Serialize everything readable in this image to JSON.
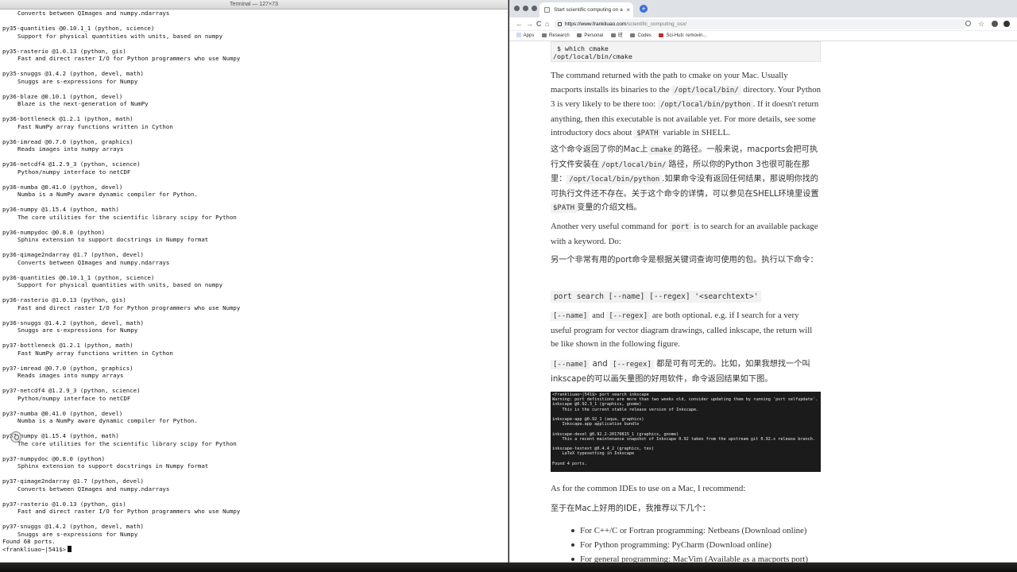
{
  "terminal": {
    "title": "Terminal — 127×73",
    "entries": [
      {
        "head": null,
        "desc": "Converts between QImages and numpy.ndarrays"
      },
      {
        "head": "py35-quantities @0.10.1_1 (python, science)",
        "desc": "Support for physical quantities with units, based on numpy"
      },
      {
        "head": "py35-rasterio @1.0.13 (python, gis)",
        "desc": "Fast and direct raster I/O for Python programmers who use Numpy"
      },
      {
        "head": "py35-snuggs @1.4.2 (python, devel, math)",
        "desc": "Snuggs are s-expressions for Numpy"
      },
      {
        "head": "py36-blaze @0.10.1 (python, devel)",
        "desc": "Blaze is the next-generation of NumPy"
      },
      {
        "head": "py36-bottleneck @1.2.1 (python, math)",
        "desc": "Fast NumPy array functions written in Cython"
      },
      {
        "head": "py36-imread @0.7.0 (python, graphics)",
        "desc": "Reads images into numpy arrays"
      },
      {
        "head": "py36-netcdf4 @1.2.9_3 (python, science)",
        "desc": "Python/numpy interface to netCDF"
      },
      {
        "head": "py36-numba @0.41.0 (python, devel)",
        "desc": "Numba is a NumPy aware dynamic compiler for Python."
      },
      {
        "head": "py36-numpy @1.15.4 (python, math)",
        "desc": "The core utilities for the scientific library scipy for Python"
      },
      {
        "head": "py36-numpydoc @0.8.0 (python)",
        "desc": "Sphinx extension to support docstrings in Numpy format"
      },
      {
        "head": "py36-qimage2ndarray @1.7 (python, devel)",
        "desc": "Converts between QImages and numpy.ndarrays"
      },
      {
        "head": "py36-quantities @0.10.1_1 (python, science)",
        "desc": "Support for physical quantities with units, based on numpy"
      },
      {
        "head": "py36-rasterio @1.0.13 (python, gis)",
        "desc": "Fast and direct raster I/O for Python programmers who use Numpy"
      },
      {
        "head": "py36-snuggs @1.4.2 (python, devel, math)",
        "desc": "Snuggs are s-expressions for Numpy"
      },
      {
        "head": "py37-bottleneck @1.2.1 (python, math)",
        "desc": "Fast NumPy array functions written in Cython"
      },
      {
        "head": "py37-imread @0.7.0 (python, graphics)",
        "desc": "Reads images into numpy arrays"
      },
      {
        "head": "py37-netcdf4 @1.2.9_3 (python, science)",
        "desc": "Python/numpy interface to netCDF"
      },
      {
        "head": "py37-numba @0.41.0 (python, devel)",
        "desc": "Numba is a NumPy aware dynamic compiler for Python."
      },
      {
        "head": "py37-numpy @1.15.4 (python, math)",
        "desc": "The core utilities for the scientific library scipy for Python"
      },
      {
        "head": "py37-numpydoc @0.8.0 (python)",
        "desc": "Sphinx extension to support docstrings in Numpy format"
      },
      {
        "head": "py37-qimage2ndarray @1.7 (python, devel)",
        "desc": "Converts between QImages and numpy.ndarrays"
      },
      {
        "head": "py37-rasterio @1.0.13 (python, gis)",
        "desc": "Fast and direct raster I/O for Python programmers who use Numpy"
      },
      {
        "head": "py37-snuggs @1.4.2 (python, devel, math)",
        "desc": "Snuggs are s-expressions for Numpy"
      }
    ],
    "found": "Found 68 ports.",
    "prompt": "<frankliuao~|541$>"
  },
  "browser": {
    "tab_title": "Start scientific computing on a",
    "tab_close": "×",
    "new_tab": "+",
    "url_host": "https://www.frankliuao.com",
    "url_path": "/scientific_computing_osx/",
    "nav_back": "←",
    "nav_forward": "→",
    "nav_reload": "C",
    "nav_home": "⌂",
    "bookmarks": [
      "Apps",
      "Research",
      "Personal",
      "班",
      "Codes",
      "Sci-Hub: removin..."
    ]
  },
  "article": {
    "code_top_1": " $ which cmake",
    "code_top_2": "/opt/local/bin/cmake",
    "p1_a": "The command returned with the path to cmake on your Mac. Usually macports installs its binaries to the",
    "p1_c1": "/opt/local/bin/",
    "p1_b": "directory. Your Python 3 is very likely to be there too:",
    "p1_c2": "/opt/local/bin/python",
    "p1_c": ". If it doesn't return anything, then this executable is not available yet. For more details, see some introductory docs about",
    "p1_c3": "$PATH",
    "p1_d": "variable in SHELL.",
    "p2_a": "这个命令返回了你的Mac上",
    "p2_c1": "cmake",
    "p2_b": "的路径。一般来说，macports会把可执行文件安装在",
    "p2_c2": "/opt/local/bin/",
    "p2_c": "路径，所以你的Python 3也很可能在那里：",
    "p2_c3": "/opt/local/bin/python",
    "p2_d": ".如果命令没有返回任何结果，那说明你找的可执行文件还不存在。关于这个命令的详情，可以参见在SHELL环境里设置",
    "p2_c4": "$PATH",
    "p2_e": "变量的介绍文档。",
    "p3_a": "Another very useful command for",
    "p3_c1": "port",
    "p3_b": "is to search for an available package with a keyword. Do:",
    "p4": "另一个非常有用的port命令是根据关键词查询可使用的包。执行以下命令：",
    "cmd": "port search [--name] [--regex] '<searchtext>'",
    "p5_c1": "[--name]",
    "p5_a": "and",
    "p5_c2": "[--regex]",
    "p5_b": "are both optional. e.g. if I search for a very useful program for vector diagram drawings, called inkscape, the return will be like shown in the following figure.",
    "p6_c1": "[--name]",
    "p6_a": "and",
    "p6_c2": "[--regex]",
    "p6_b": "都是可有可无的。比如，如果我想找一个叫inkscape的可以画矢量图的好用软件，命令返回结果如下图。",
    "shot_lines": [
      "<frankliuao~|541$> port search inkscape",
      "Warning: port definitions are more than two weeks old, consider updating them by running 'port selfupdate'.",
      "inkscape @0.92.3_1 (graphics, gnome)",
      "    This is the current stable release version of Inkscape.",
      "",
      "inkscape-app @0.92_1 (aqua, graphics)",
      "    Inkscape.app application bundle",
      "",
      "inkscape-devel @0.92.2-20170815_1 (graphics, gnome)",
      "    This a recent maintenance snapshot of Inkscape 0.92 taken from the upstream git 0.92.x release branch.",
      "",
      "inkscape-textext @0.4.4_2 (graphics, tex)",
      "    LaTeX typesetting in Inkscape",
      "",
      "Found 4 ports."
    ],
    "p7": "As for the common IDEs to use on a Mac, I recommend:",
    "p8": "至于在Mac上好用的IDE，我推荐以下几个：",
    "list": [
      "For C++/C or Fortran programming: Netbeans (Download online)",
      "For Python programming: PyCharm (Download online)",
      "For general programming: MacVim (Available as a macports port)"
    ]
  }
}
